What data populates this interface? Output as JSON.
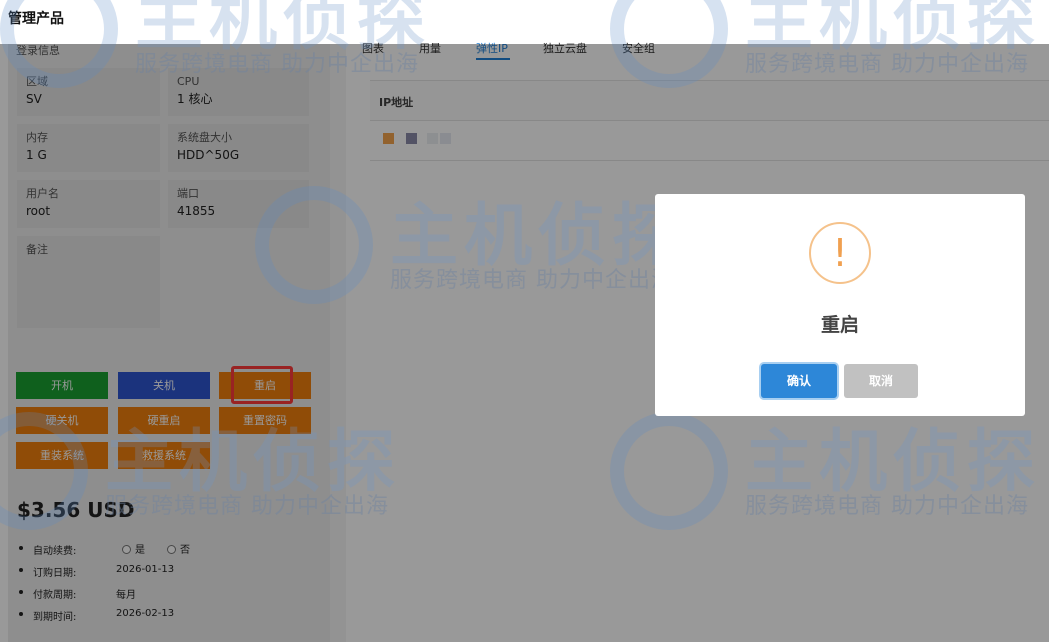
{
  "header": {
    "title": "管理产品"
  },
  "login_info": {
    "section_label": "登录信息",
    "fields": [
      {
        "label": "区域",
        "value": "SV"
      },
      {
        "label": "CPU",
        "value": "1 核心"
      },
      {
        "label": "内存",
        "value": "1 G"
      },
      {
        "label": "系统盘大小",
        "value": "HDD^50G"
      },
      {
        "label": "用户名",
        "value": "root"
      },
      {
        "label": "端口",
        "value": "41855"
      },
      {
        "label": "备注",
        "value": ""
      }
    ]
  },
  "actions": {
    "power_on": "开机",
    "power_off": "关机",
    "reboot": "重启",
    "hard_off": "硬关机",
    "hard_reboot": "硬重启",
    "reset_password": "重置密码",
    "reinstall": "重装系统",
    "rescue": "救援系统"
  },
  "billing": {
    "price": "$3.56 USD",
    "auto_renew_label": "自动续费:",
    "auto_renew_yes": "是",
    "auto_renew_no": "否",
    "order_date_label": "订购日期:",
    "order_date": "2026-01-13",
    "billing_cycle_label": "付款周期:",
    "billing_cycle": "每月",
    "expiry_label": "到期时间:",
    "expiry": "2026-02-13"
  },
  "tabs": [
    {
      "label": "图表"
    },
    {
      "label": "用量"
    },
    {
      "label": "弹性IP"
    },
    {
      "label": "独立云盘"
    },
    {
      "label": "安全组"
    }
  ],
  "ip_table": {
    "header": "IP地址"
  },
  "colors": {
    "accent": "#1f7fd6",
    "start": "#1aa031",
    "stop": "#2e55d1",
    "warning": "#f07f0c",
    "highlight": "#ff3b3b"
  },
  "watermark": {
    "brand": "主机侦探",
    "slogan": "服务跨境电商 助力中企出海"
  },
  "dialog": {
    "icon": "warning-icon",
    "title": "重启",
    "confirm": "确认",
    "cancel": "取消"
  }
}
